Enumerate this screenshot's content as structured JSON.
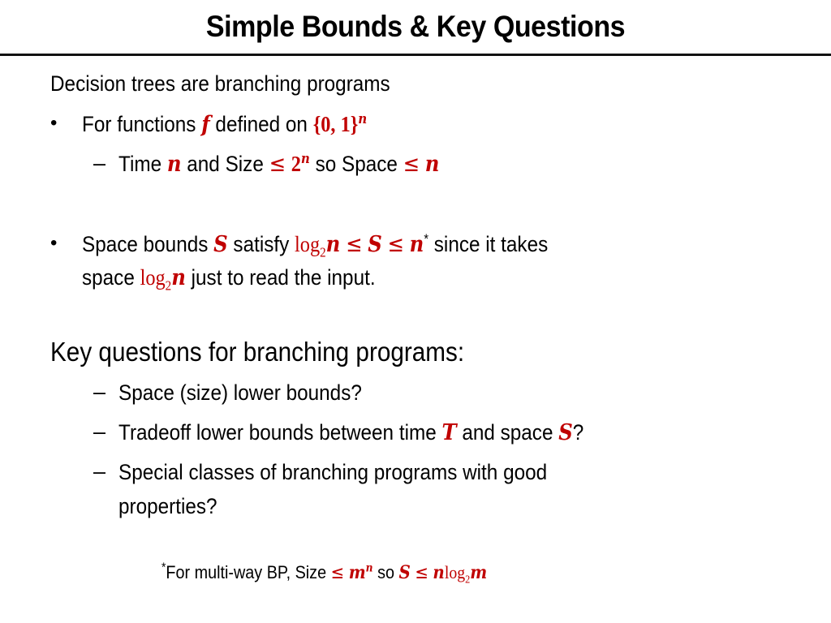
{
  "slide": {
    "title": "Simple Bounds & Key Questions",
    "intro": "Decision trees are branching programs",
    "bullet1": {
      "symbol": "•",
      "text_before": "For functions ",
      "var_f": "f",
      "text_mid": " defined on ",
      "set": "{0, 1}",
      "set_exp": "n",
      "sub1": {
        "symbol": "–",
        "t1": "Time ",
        "n1": "n",
        "t2": " and Size ",
        "le1": "≤",
        "two": "2",
        "two_exp": "n",
        "t3": " so Space ",
        "le2": "≤",
        "n2": "n"
      }
    },
    "bullet2": {
      "symbol": "•",
      "t1": "Space bounds ",
      "S1": "S",
      "t2": " satisfy ",
      "log1": "log",
      "log1_sub": "2",
      "n1": "n",
      "le1": "≤",
      "S2": "S",
      "le2": "≤",
      "n2": "n",
      "star": "*",
      "t3": " since it takes",
      "line2_t1": "space ",
      "log2": "log",
      "log2_sub": "2",
      "n3": "n",
      "line2_t2": " just to read the input."
    },
    "key_heading": "Key questions for branching programs:",
    "questions": [
      {
        "symbol": "–",
        "text": "Space (size) lower bounds?"
      },
      {
        "symbol": "–",
        "t1": "Tradeoff lower bounds between time ",
        "T": "T",
        "t2": " and space ",
        "S": "S",
        "t3": "?"
      },
      {
        "symbol": "–",
        "line1": "Special classes of branching programs with good",
        "line2": "properties?"
      }
    ],
    "footnote": {
      "star": "*",
      "t1": "For multi-way BP, Size ",
      "le1": "≤",
      "m": "m",
      "m_exp": "n",
      "t2": " so ",
      "S": "S",
      "le2": "≤",
      "n": "n",
      "log": "log",
      "log_sub": "2",
      "m2": "m"
    },
    "colors": {
      "accent_red": "#c00000",
      "text": "#000000"
    }
  }
}
